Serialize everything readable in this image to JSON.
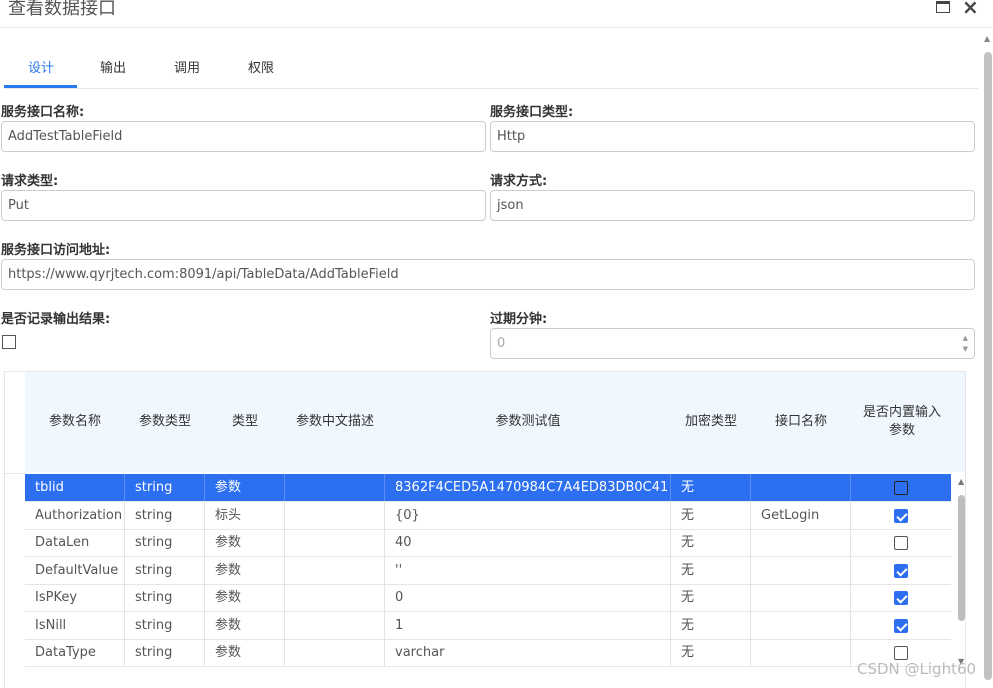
{
  "window": {
    "title": "查看数据接口",
    "maximize_icon": "maximize-icon",
    "close_icon": "×"
  },
  "tabs": [
    {
      "label": "设计",
      "active": true
    },
    {
      "label": "输出",
      "active": false
    },
    {
      "label": "调用",
      "active": false
    },
    {
      "label": "权限",
      "active": false
    }
  ],
  "form": {
    "service_name": {
      "label": "服务接口名称:",
      "value": "AddTestTableField"
    },
    "service_type": {
      "label": "服务接口类型:",
      "value": "Http"
    },
    "request_type": {
      "label": "请求类型:",
      "value": "Put"
    },
    "request_method": {
      "label": "请求方式:",
      "value": "json"
    },
    "url": {
      "label": "服务接口访问地址:",
      "value": "https://www.qyrjtech.com:8091/api/TableData/AddTableField"
    },
    "record_output": {
      "label": "是否记录输出结果:",
      "checked": false
    },
    "expire_minutes": {
      "label": "过期分钟:",
      "value": "0"
    }
  },
  "grid": {
    "columns": [
      "参数名称",
      "参数类型",
      "类型",
      "参数中文描述",
      "参数测试值",
      "加密类型",
      "接口名称",
      "是否内置输入参数"
    ],
    "rows": [
      {
        "name": "tblid",
        "ptype": "string",
        "kind": "参数",
        "desc": "",
        "test": "8362F4CED5A1470984C7A4ED83DB0C41",
        "enc": "无",
        "iface": "",
        "builtin": false,
        "selected": true
      },
      {
        "name": "Authorization",
        "ptype": "string",
        "kind": "标头",
        "desc": "",
        "test": "{0}",
        "enc": "无",
        "iface": "GetLogin",
        "builtin": true,
        "selected": false
      },
      {
        "name": "DataLen",
        "ptype": "string",
        "kind": "参数",
        "desc": "",
        "test": "40",
        "enc": "无",
        "iface": "",
        "builtin": false,
        "selected": false
      },
      {
        "name": "DefaultValue",
        "ptype": "string",
        "kind": "参数",
        "desc": "",
        "test": "''",
        "enc": "无",
        "iface": "",
        "builtin": true,
        "selected": false
      },
      {
        "name": "IsPKey",
        "ptype": "string",
        "kind": "参数",
        "desc": "",
        "test": "0",
        "enc": "无",
        "iface": "",
        "builtin": true,
        "selected": false
      },
      {
        "name": "IsNill",
        "ptype": "string",
        "kind": "参数",
        "desc": "",
        "test": "1",
        "enc": "无",
        "iface": "",
        "builtin": true,
        "selected": false
      },
      {
        "name": "DataType",
        "ptype": "string",
        "kind": "参数",
        "desc": "",
        "test": "varchar",
        "enc": "无",
        "iface": "",
        "builtin": false,
        "selected": false
      }
    ]
  },
  "watermark": "CSDN @Light60",
  "colors": {
    "accent": "#2878f0",
    "selected_row": "#2c6ff0",
    "header_bg": "#f0f7ff"
  }
}
